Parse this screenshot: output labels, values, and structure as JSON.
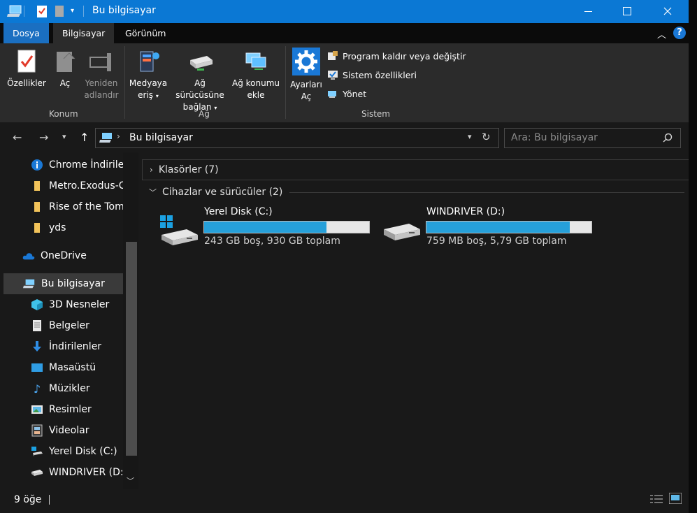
{
  "titlebar": {
    "title": "Bu bilgisayar"
  },
  "tabs": [
    {
      "label": "Dosya"
    },
    {
      "label": "Bilgisayar"
    },
    {
      "label": "Görünüm"
    }
  ],
  "ribbon": {
    "konum": {
      "label": "Konum",
      "properties": "Özellikler",
      "open": "Aç",
      "rename_1": "Yeniden",
      "rename_2": "adlandır"
    },
    "ag": {
      "label": "Ağ",
      "media_1": "Medyaya",
      "media_2": "eriş",
      "map_1": "Ağ sürücüsüne",
      "map_2": "bağlan",
      "addloc_1": "Ağ konumu",
      "addloc_2": "ekle"
    },
    "sistem": {
      "label": "Sistem",
      "settings_1": "Ayarları",
      "settings_2": "Aç",
      "uninstall": "Program kaldır veya değiştir",
      "sysprops": "Sistem özellikleri",
      "manage": "Yönet"
    }
  },
  "address": {
    "path": "Bu bilgisayar",
    "search_placeholder": "Ara: Bu bilgisayar"
  },
  "nav_items": [
    {
      "label": "Chrome İndirilenler"
    },
    {
      "label": "Metro.Exodus-CPY"
    },
    {
      "label": "Rise of the Tomb Raider"
    },
    {
      "label": "yds"
    },
    {
      "label": "OneDrive"
    },
    {
      "label": "Bu bilgisayar"
    },
    {
      "label": "3D Nesneler"
    },
    {
      "label": "Belgeler"
    },
    {
      "label": "İndirilenler"
    },
    {
      "label": "Masaüstü"
    },
    {
      "label": "Müzikler"
    },
    {
      "label": "Resimler"
    },
    {
      "label": "Videolar"
    },
    {
      "label": "Yerel Disk (C:)"
    },
    {
      "label": "WINDRIVER (D:)"
    }
  ],
  "content": {
    "folders_group": "Klasörler (7)",
    "devices_group": "Cihazlar ve sürücüler (2)",
    "drives": [
      {
        "name": "Yerel Disk (C:)",
        "info": "243 GB boş, 930 GB toplam",
        "used_fraction": 0.74
      },
      {
        "name": "WINDRIVER (D:)",
        "info": "759 MB boş, 5,79 GB toplam",
        "used_fraction": 0.87
      }
    ]
  },
  "status": {
    "count": "9 öğe"
  },
  "colors": {
    "accent": "#0b78d4",
    "bar_fill": "#26a0da"
  }
}
